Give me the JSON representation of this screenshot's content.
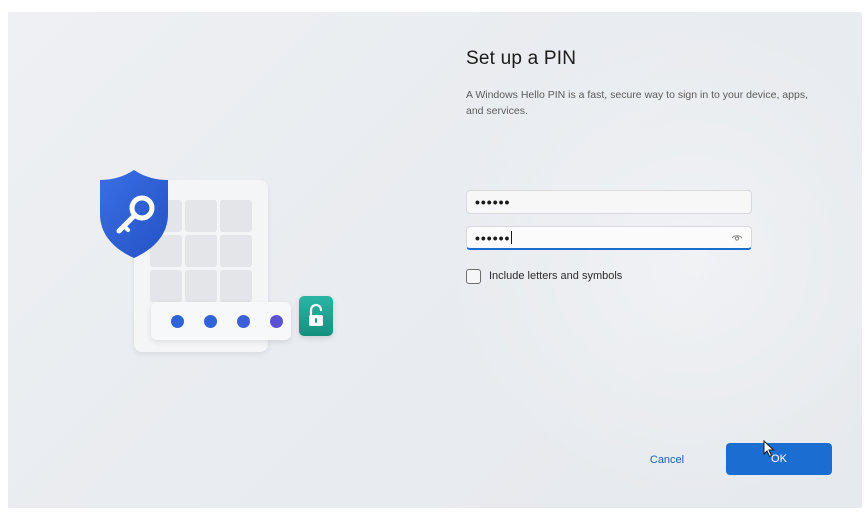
{
  "setup": {
    "title": "Set up a PIN",
    "description": "A Windows Hello PIN is a fast, secure way to sign in to your device, apps, and services."
  },
  "new_pin": {
    "value": "••••••"
  },
  "confirm_pin": {
    "value": "••••••",
    "reveal_icon": "eye-icon"
  },
  "options": {
    "include_letters_label": "Include letters and symbols",
    "include_letters_checked": false
  },
  "actions": {
    "cancel_label": "Cancel",
    "ok_label": "OK"
  },
  "illustration": {
    "shield_icon": "key-shield-icon",
    "lock_icon": "unlock-icon",
    "pin_dot_colors": [
      "#2f63d6",
      "#2f63d6",
      "#3d5fd8",
      "#5b51d3"
    ]
  },
  "colors": {
    "accent": "#1a6dd1",
    "shield_blue": "#2d62d8",
    "lock_teal": "#1ea596"
  }
}
